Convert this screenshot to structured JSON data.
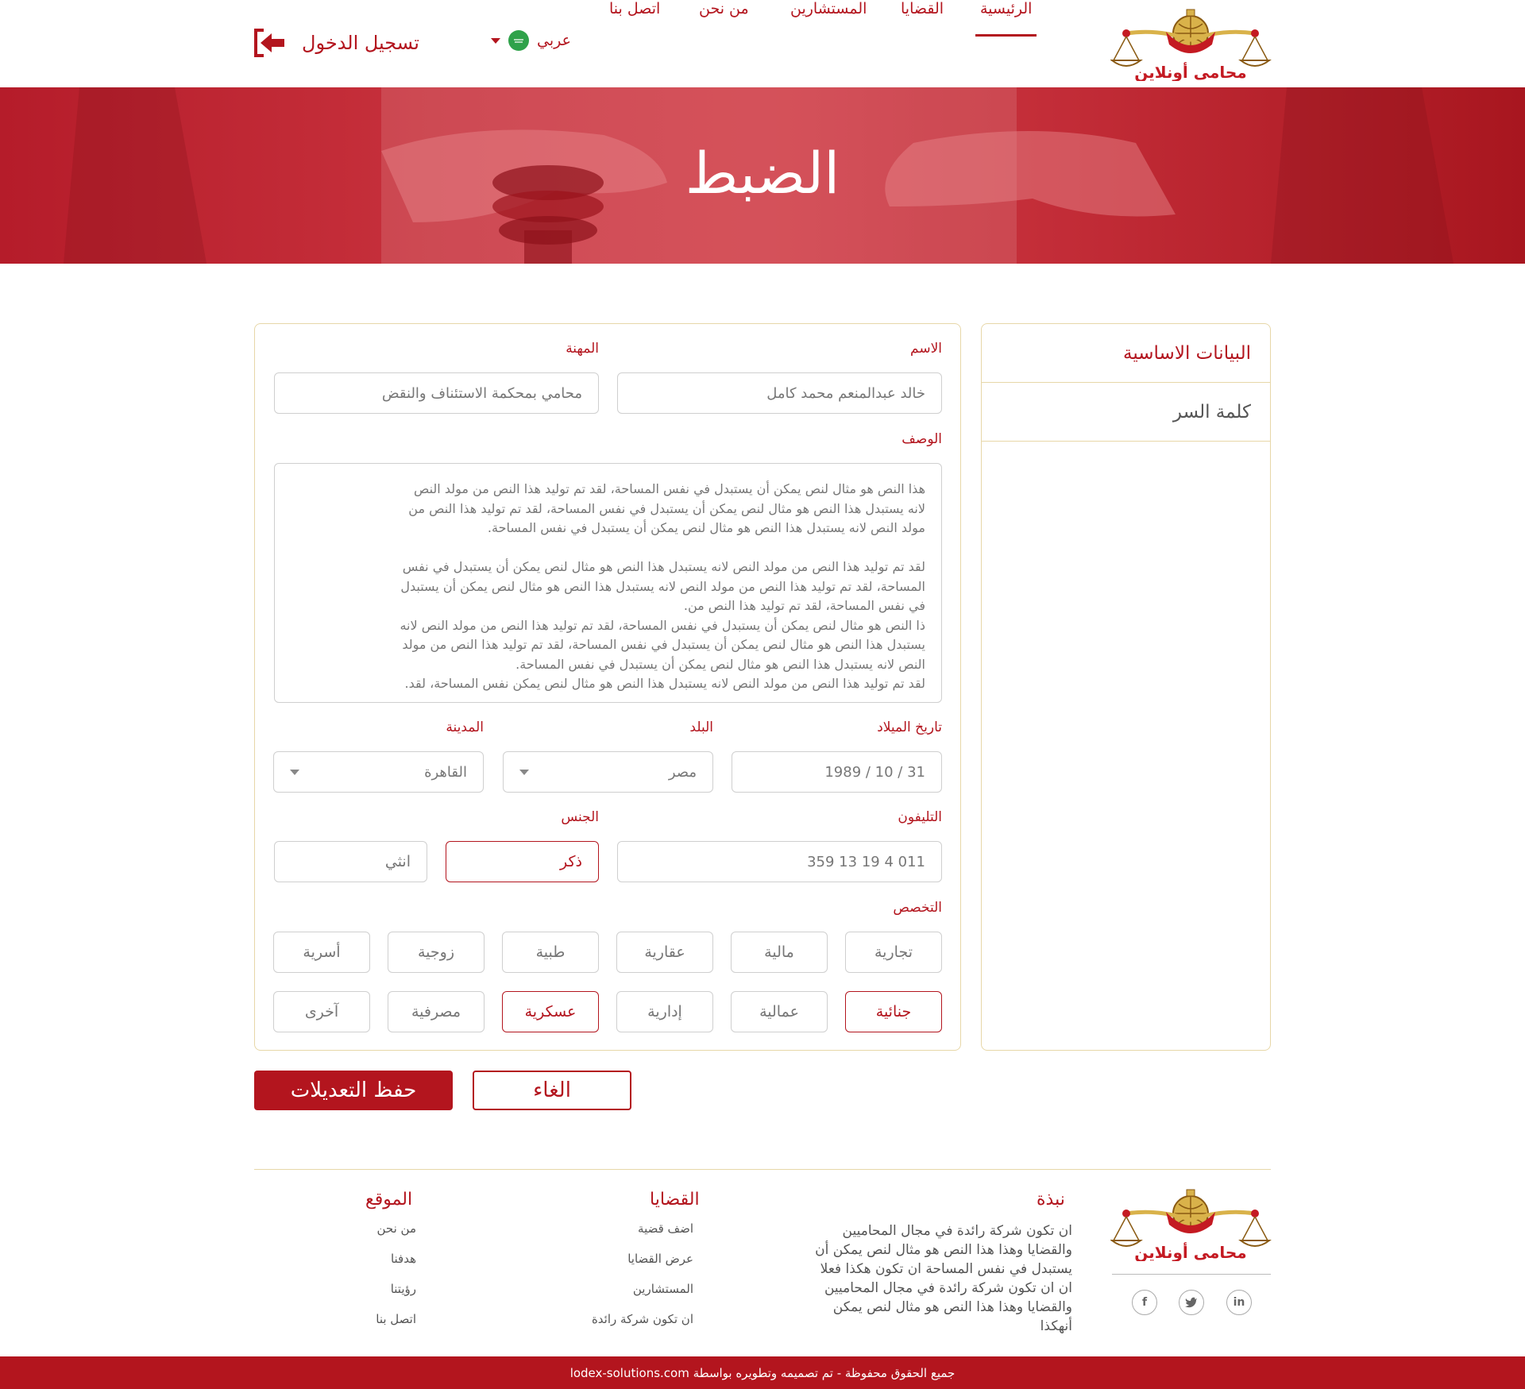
{
  "brand": {
    "name": "محامى أونلاين",
    "accent": "#b3151e",
    "gold": "#d9b24a"
  },
  "nav": {
    "items": [
      {
        "label": "الرئيسية",
        "active": true
      },
      {
        "label": "القضايا"
      },
      {
        "label": "المستشارين"
      },
      {
        "label": "من نحن"
      },
      {
        "label": "اتصل بنا"
      }
    ],
    "language": "عربي",
    "login": "تسجيل الدخول"
  },
  "hero": {
    "title": "الضبط"
  },
  "sidebar": {
    "items": [
      {
        "label": "البيانات الاساسية",
        "active": true
      },
      {
        "label": "كلمة السر",
        "active": false
      }
    ]
  },
  "form": {
    "name": {
      "label": "الاسم",
      "value": "خالد عبدالمنعم محمد كامل"
    },
    "profession": {
      "label": "المهنة",
      "value": "محامي بمحكمة الاستئناف والنقض"
    },
    "description": {
      "label": "الوصف",
      "value": "هذا النص هو مثال لنص يمكن أن يستبدل في نفس المساحة، لقد تم توليد هذا النص من مولد النص\nلانه يستبدل هذا النص هو مثال لنص يمكن أن يستبدل في نفس المساحة، لقد تم توليد هذا النص من\nمولد النص لانه يستبدل هذا النص هو مثال لنص يمكن أن يستبدل في نفس المساحة.\n\nلقد تم توليد هذا النص من مولد النص لانه يستبدل هذا النص هو مثال لنص يمكن أن يستبدل في نفس\nالمساحة، لقد تم توليد هذا النص من مولد النص لانه يستبدل هذا النص هو مثال لنص يمكن أن يستبدل\nفي نفس المساحة، لقد تم توليد هذا النص من.\nذا النص هو مثال لنص يمكن أن يستبدل في نفس المساحة، لقد تم توليد هذا النص من مولد النص لانه\nيستبدل هذا النص هو مثال لنص يمكن أن يستبدل في نفس المساحة، لقد تم توليد هذا النص من مولد\nالنص لانه يستبدل هذا النص هو مثال لنص يمكن أن يستبدل في نفس المساحة.\nلقد تم توليد هذا النص من مولد النص لانه يستبدل هذا النص هو مثال لنص يمكن نفس المساحة، لقد."
    },
    "birthdate": {
      "label": "تاريخ الميلاد",
      "value": "31 / 10 / 1989"
    },
    "country": {
      "label": "البلد",
      "value": "مصر"
    },
    "city": {
      "label": "المدينة",
      "value": "القاهرة"
    },
    "phone": {
      "label": "التليفون",
      "value": "011 4 19 13 359"
    },
    "gender": {
      "label": "الجنس",
      "options": [
        "ذكر",
        "انثي"
      ],
      "selected": "ذكر"
    },
    "specialty": {
      "label": "التخصص",
      "options": [
        {
          "label": "تجارية",
          "selected": false
        },
        {
          "label": "مالية",
          "selected": false
        },
        {
          "label": "عقارية",
          "selected": false
        },
        {
          "label": "طبية",
          "selected": false
        },
        {
          "label": "زوجية",
          "selected": false
        },
        {
          "label": "أسرية",
          "selected": false
        },
        {
          "label": "جنائية",
          "selected": true
        },
        {
          "label": "عمالية",
          "selected": false
        },
        {
          "label": "إدارية",
          "selected": false
        },
        {
          "label": "عسكرية",
          "selected": true
        },
        {
          "label": "مصرفية",
          "selected": false
        },
        {
          "label": "آخرى",
          "selected": false
        }
      ]
    }
  },
  "actions": {
    "save": "حفظ التعديلات",
    "cancel": "الغاء"
  },
  "footer": {
    "about_title": "نبذة",
    "about_text": "ان تكون شركة رائدة في مجال المحاميين والقضايا وهذا  هذا النص هو مثال لنص يمكن أن يستبدل في نفس المساحة ان تكون هكذا فعلا ان ان تكون شركة رائدة في مجال المحاميين والقضايا وهذا  هذا النص هو مثال لنص يمكن أنهكذا",
    "cases_title": "القضايا",
    "cases_links": [
      "اضف قضية",
      "عرض القضايا",
      "المستشارين",
      "ان تكون شركة رائدة"
    ],
    "site_title": "الموقع",
    "site_links": [
      "من نحن",
      "هدفنا",
      "رؤيتنا",
      "اتصل بنا"
    ],
    "social": [
      "in",
      "twitter-icon",
      "f"
    ],
    "copyright": "جميع الحقوق محفوظة - تم تصميمه وتطويره بواسطة lodex-solutions.com"
  }
}
